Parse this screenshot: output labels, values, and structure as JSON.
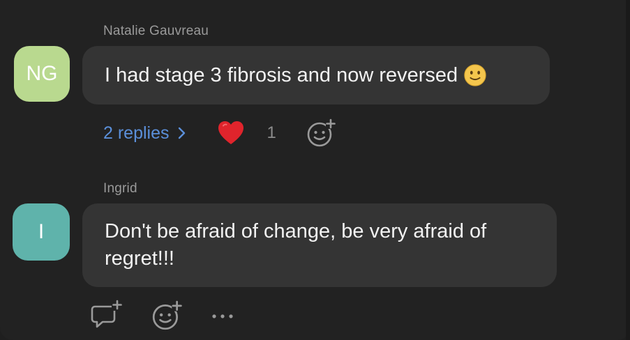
{
  "messages": [
    {
      "sender": "Natalie Gauvreau",
      "initials": "NG",
      "avatar_color": "#b9d98f",
      "text": "I had stage 3 fibrosis and now reversed",
      "trailing_emoji": "slightly-smiling-face-icon",
      "replies_label": "2 replies",
      "reaction": {
        "icon": "heart-icon",
        "count": "1"
      }
    },
    {
      "sender": "Ingrid",
      "initials": "I",
      "avatar_color": "#5fb3ab",
      "text_line1": "Don't be afraid of change, be very afraid of",
      "text_line2": "regret!!!"
    }
  ],
  "actions": [
    "reply-thread-icon",
    "add-reaction-icon",
    "more-options-icon"
  ],
  "colors": {
    "background": "#222222",
    "bubble": "#343434",
    "link": "#5b8fd9",
    "muted": "#9a9a9a"
  }
}
